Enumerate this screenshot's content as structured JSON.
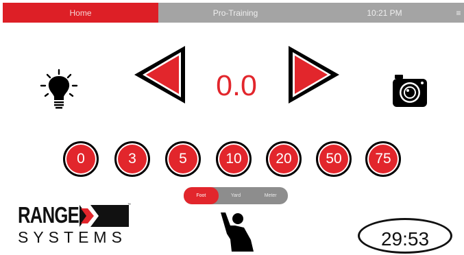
{
  "topbar": {
    "home_label": "Home",
    "title": "Pro-Training",
    "time": "10:21 PM",
    "menu_icon": "≡"
  },
  "distance_display": "0.0",
  "presets": [
    "0",
    "3",
    "5",
    "10",
    "20",
    "50",
    "75"
  ],
  "units": {
    "options": [
      "Foot",
      "Yard",
      "Meter"
    ],
    "selected": "Foot"
  },
  "logo": {
    "line1": "RANGE",
    "line2": "SYSTEMS"
  },
  "timer": "29:53",
  "icons": {
    "left": "lightbulb-icon",
    "right": "camera-icon",
    "prev": "left-arrow-icon",
    "next": "right-arrow-icon",
    "bottom": "hand-raised-icon"
  },
  "colors": {
    "accent": "#e2262c",
    "topbar_gray": "#a4a4a4",
    "toggle_gray": "#8d8d8d"
  }
}
